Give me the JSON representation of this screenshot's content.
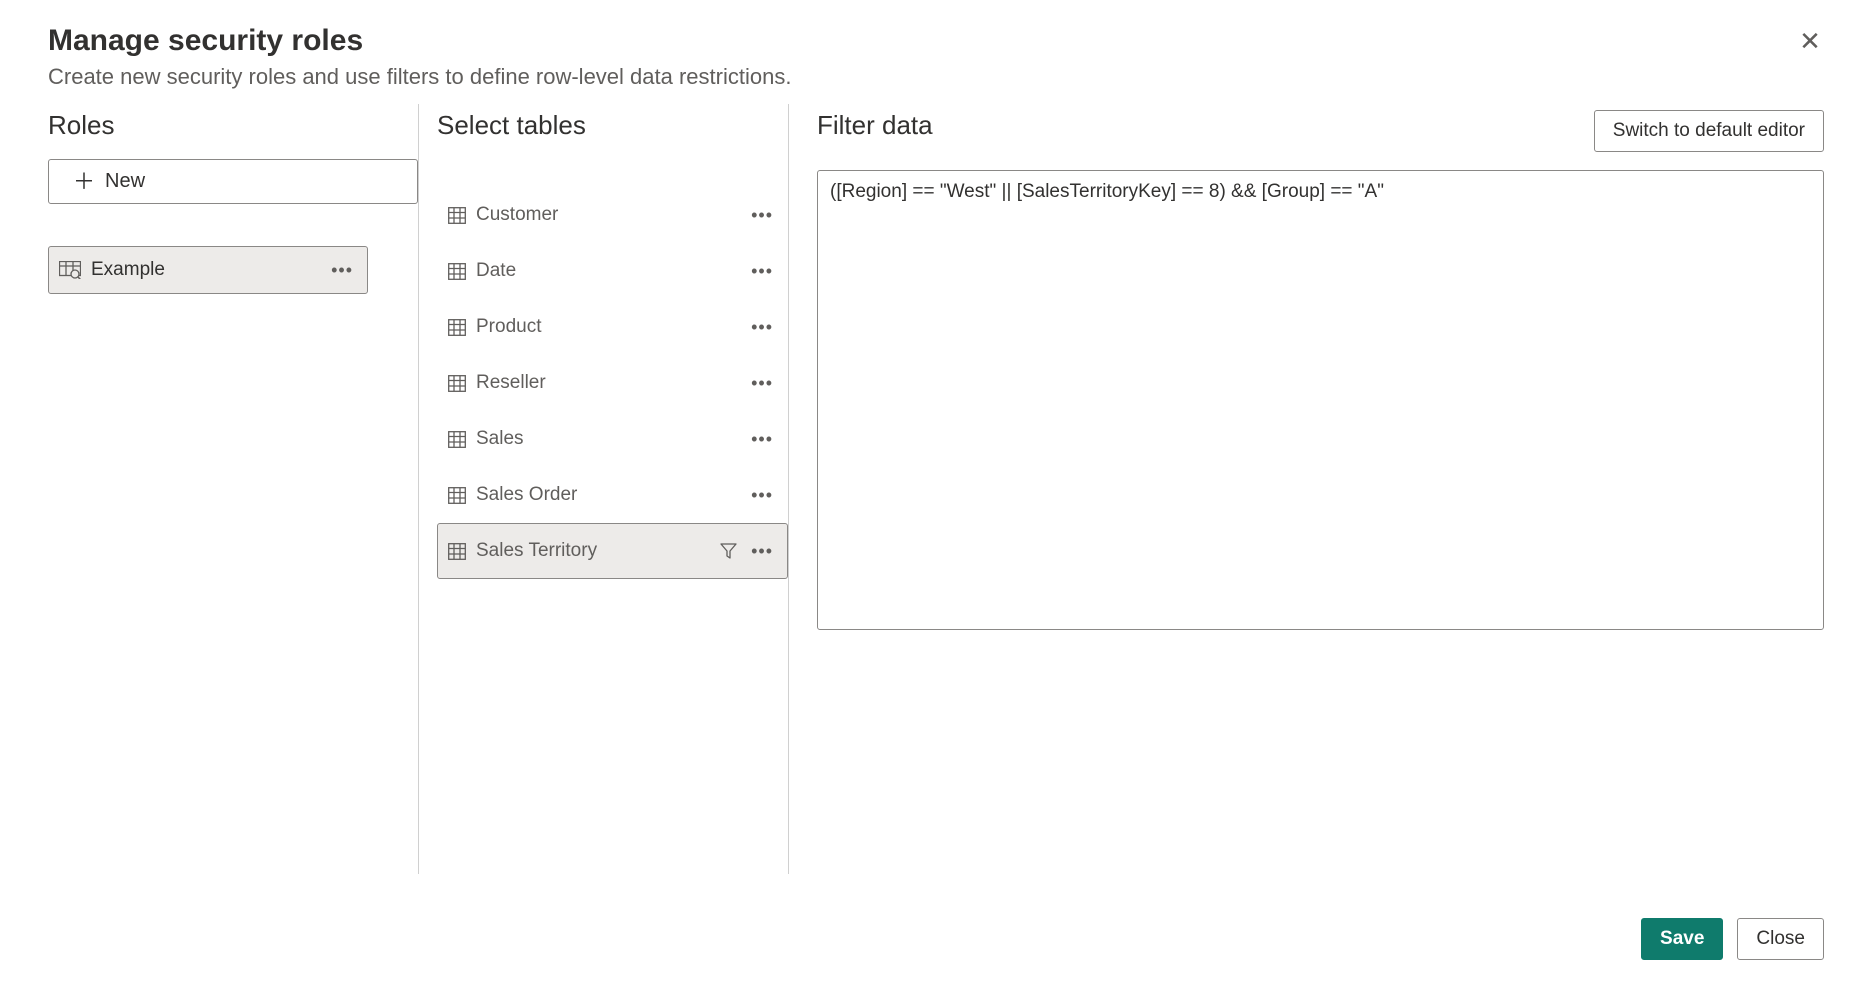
{
  "dialog": {
    "title": "Manage security roles",
    "subtitle": "Create new security roles and use filters to define row-level data restrictions."
  },
  "roles_panel": {
    "heading": "Roles",
    "new_button_label": "New",
    "items": [
      {
        "label": "Example",
        "selected": true
      }
    ]
  },
  "tables_panel": {
    "heading": "Select tables",
    "items": [
      {
        "label": "Customer",
        "selected": false,
        "has_filter": false
      },
      {
        "label": "Date",
        "selected": false,
        "has_filter": false
      },
      {
        "label": "Product",
        "selected": false,
        "has_filter": false
      },
      {
        "label": "Reseller",
        "selected": false,
        "has_filter": false
      },
      {
        "label": "Sales",
        "selected": false,
        "has_filter": false
      },
      {
        "label": "Sales Order",
        "selected": false,
        "has_filter": false
      },
      {
        "label": "Sales Territory",
        "selected": true,
        "has_filter": true
      }
    ]
  },
  "filter_panel": {
    "heading": "Filter data",
    "switch_label": "Switch to default editor",
    "expression": "([Region] == \"West\" || [SalesTerritoryKey] == 8) && [Group] == \"A\""
  },
  "footer": {
    "save_label": "Save",
    "close_label": "Close"
  }
}
